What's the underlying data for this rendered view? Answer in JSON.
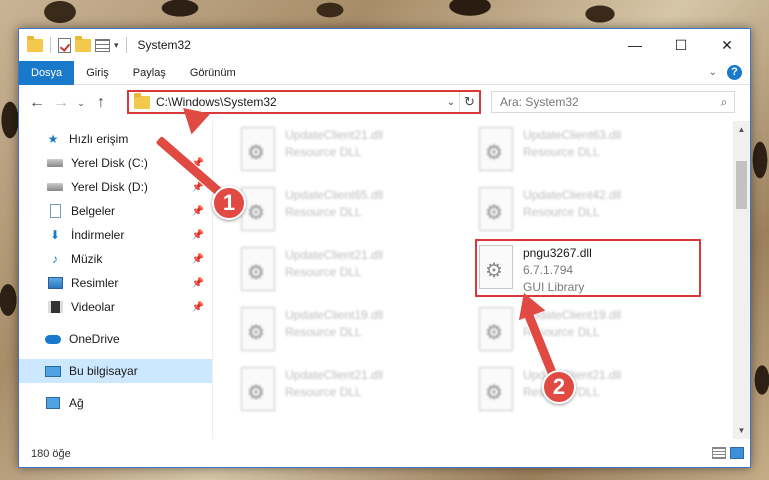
{
  "window": {
    "title": "System32",
    "controls": {
      "minimize": "—",
      "maximize": "☐",
      "close": "✕"
    }
  },
  "ribbon": {
    "tabs": [
      "Dosya",
      "Giriş",
      "Paylaş",
      "Görünüm"
    ],
    "active_tab": "Dosya",
    "expand_icon": "⌄",
    "help_icon": "?"
  },
  "nav_buttons": {
    "back": "←",
    "forward": "→",
    "recent": "⌄",
    "up": "↑"
  },
  "address": {
    "path": "C:\\Windows\\System32",
    "dropdown": "⌄",
    "refresh": "↻"
  },
  "search": {
    "placeholder": "Ara: System32",
    "icon": "⌕"
  },
  "sidebar": {
    "quick_access": "Hızlı erişim",
    "pinned": [
      {
        "label": "Yerel Disk (C:)",
        "icon": "drive-icon"
      },
      {
        "label": "Yerel Disk (D:)",
        "icon": "drive-icon"
      },
      {
        "label": "Belgeler",
        "icon": "documents-icon"
      },
      {
        "label": "İndirmeler",
        "icon": "download-icon"
      },
      {
        "label": "Müzik",
        "icon": "music-icon"
      },
      {
        "label": "Resimler",
        "icon": "pictures-icon"
      },
      {
        "label": "Videolar",
        "icon": "videos-icon"
      }
    ],
    "onedrive": "OneDrive",
    "this_pc": "Bu bilgisayar",
    "network": "Ağ",
    "pin_glyph": "📌"
  },
  "files": [
    {
      "name": "UpdateClient21.dll",
      "type": "Resource DLL"
    },
    {
      "name": "UpdateClient63.dll",
      "type": "Resource DLL"
    },
    {
      "name": "UpdateClient65.dll",
      "type": "Resource DLL"
    },
    {
      "name": "UpdateClient42.dll",
      "type": "Resource DLL"
    },
    {
      "name": "UpdateClient21.dll",
      "type": "Resource DLL"
    },
    {
      "name": "pngu3267.dll",
      "version": "6.7.1.794",
      "type": "GUI Library"
    },
    {
      "name": "UpdateClient19.dll",
      "type": "Resource DLL"
    },
    {
      "name": "UpdateClient19.dll",
      "type": "Resource DLL"
    },
    {
      "name": "UpdateClient21.dll",
      "type": "Resource DLL"
    },
    {
      "name": "UpdateClient21.dll",
      "type": "Resource DLL"
    }
  ],
  "status": {
    "item_count": "180 öğe"
  },
  "annotations": {
    "step1": "1",
    "step2": "2"
  },
  "colors": {
    "accent": "#1979ca",
    "highlight": "#d9393a",
    "annotation": "#e04a43"
  }
}
